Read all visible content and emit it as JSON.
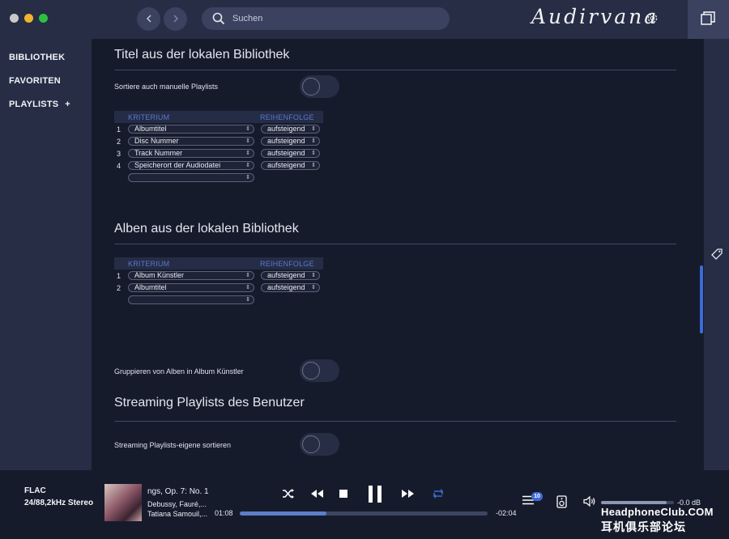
{
  "window": {
    "search_placeholder": "Suchen",
    "logo_text": "Audirvana"
  },
  "sidebar": {
    "items": [
      {
        "label": "BIBLIOTHEK"
      },
      {
        "label": "FAVORITEN"
      },
      {
        "label": "PLAYLISTS"
      }
    ],
    "add_symbol": "+"
  },
  "main": {
    "section1": {
      "title": "Titel aus der lokalen Bibliothek",
      "option_label": "Sortiere auch manuelle Playlists",
      "table": {
        "headers": [
          "KRITERIUM",
          "REIHENFOLGE"
        ],
        "rows": [
          {
            "num": "1",
            "criterion": "Albumtitel",
            "order": "aufsteigend"
          },
          {
            "num": "2",
            "criterion": "Disc Nummer",
            "order": "aufsteigend"
          },
          {
            "num": "3",
            "criterion": "Track Nummer",
            "order": "aufsteigend"
          },
          {
            "num": "4",
            "criterion": "Speicherort der Audiodatei",
            "order": "aufsteigend"
          }
        ]
      }
    },
    "section2": {
      "title": "Alben aus der lokalen Bibliothek",
      "option_label": "Gruppieren von Alben in Album Künstler",
      "table": {
        "headers": [
          "KRITERIUM",
          "REIHENFOLGE"
        ],
        "rows": [
          {
            "num": "1",
            "criterion": "Album Künstler",
            "order": "aufsteigend"
          },
          {
            "num": "2",
            "criterion": "Albumtitel",
            "order": "aufsteigend"
          }
        ]
      }
    },
    "section3": {
      "title": "Streaming Playlists des Benutzer",
      "option_label": "Streaming Playlists-eigene sortieren"
    }
  },
  "player": {
    "format": "FLAC",
    "format_detail": "24/88,2kHz Stereo",
    "track_title": "ngs, Op. 7: No. 1",
    "track_composer": "Debussy, Fauré,...",
    "track_artist": "Tatiana Samouil,...",
    "elapsed": "01:08",
    "remaining": "-02:04",
    "progress": 0.35,
    "queue_count": "10",
    "volume_value": "-0.0 dB",
    "volume_level": 0.9,
    "colors": {
      "accent": "#3d6bd6",
      "background": "#161b2c",
      "panel": "#262d45"
    }
  },
  "watermark": {
    "line1": "HeadphoneClub.COM",
    "line2": "耳机俱乐部论坛"
  }
}
